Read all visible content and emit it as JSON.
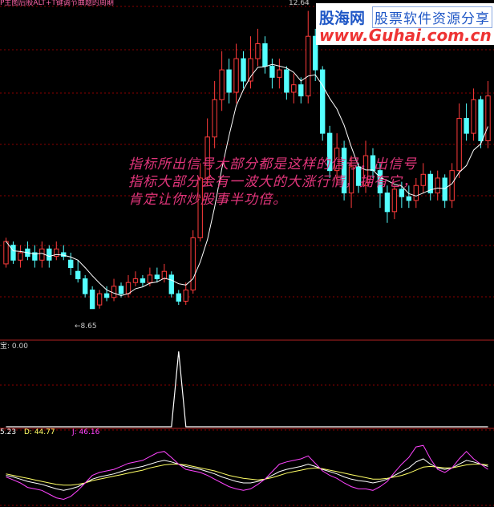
{
  "header": {
    "indicator_title": "P主图后股ALT+T键调节曲题的周期",
    "high_label": "12.64",
    "low_label": "←8.65"
  },
  "watermark": {
    "title": "股海网",
    "subtitle": "股票软件资源分享",
    "url": "www.Guhai.com.cn"
  },
  "annotation": {
    "line1": "指标所出信号大部分都是这样的信号，出信号",
    "line2": "指标大部分会有一波大的大涨行情，拥有它，",
    "line3": "肯定让你炒股事半功倍。"
  },
  "signal_panel": {
    "label": "宝: 0.00"
  },
  "kdj_panel": {
    "k_label": "5.23",
    "d_label": "D: 44.77",
    "j_label": "J: 46.16"
  },
  "colors": {
    "up": "#ff3b3b",
    "down": "#54ffff",
    "ma": "#ffffff",
    "grid": "#8b0000",
    "k": "#ffffff",
    "d": "#ffff66",
    "j": "#ff44ff"
  },
  "candles": [
    [
      9.25,
      9.55,
      9.6,
      9.2
    ],
    [
      9.5,
      9.3,
      9.55,
      9.25
    ],
    [
      9.3,
      9.4,
      9.5,
      9.2
    ],
    [
      9.45,
      9.35,
      9.55,
      9.3
    ],
    [
      9.4,
      9.3,
      9.5,
      9.2
    ],
    [
      9.3,
      9.45,
      9.55,
      9.2
    ],
    [
      9.45,
      9.3,
      9.5,
      9.2
    ],
    [
      9.35,
      9.45,
      9.55,
      9.3
    ],
    [
      9.4,
      9.35,
      9.5,
      9.3
    ],
    [
      9.3,
      9.2,
      9.4,
      9.1
    ],
    [
      9.15,
      9.05,
      9.3,
      9.0
    ],
    [
      9.05,
      8.85,
      9.1,
      8.8
    ],
    [
      8.9,
      8.65,
      8.95,
      8.65
    ],
    [
      8.7,
      8.85,
      8.9,
      8.65
    ],
    [
      8.85,
      8.8,
      8.95,
      8.75
    ],
    [
      8.8,
      8.95,
      9.05,
      8.75
    ],
    [
      8.95,
      8.85,
      9.0,
      8.8
    ],
    [
      8.85,
      9.0,
      9.1,
      8.8
    ],
    [
      9.0,
      9.05,
      9.15,
      8.95
    ],
    [
      9.05,
      9.0,
      9.1,
      8.95
    ],
    [
      9.0,
      9.1,
      9.2,
      8.95
    ],
    [
      9.1,
      9.05,
      9.2,
      9.0
    ],
    [
      9.05,
      9.15,
      9.25,
      9.0
    ],
    [
      9.1,
      8.85,
      9.15,
      8.8
    ],
    [
      8.85,
      8.75,
      8.9,
      8.7
    ],
    [
      8.75,
      8.9,
      9.0,
      8.7
    ],
    [
      8.9,
      9.6,
      9.7,
      8.85
    ],
    [
      9.6,
      10.4,
      10.6,
      9.55
    ],
    [
      10.4,
      10.95,
      11.2,
      10.3
    ],
    [
      10.95,
      11.45,
      11.7,
      10.8
    ],
    [
      11.45,
      11.85,
      12.1,
      11.3
    ],
    [
      11.85,
      11.55,
      12.0,
      11.4
    ],
    [
      11.55,
      12.0,
      12.2,
      11.4
    ],
    [
      12.0,
      11.7,
      12.1,
      11.6
    ],
    [
      11.7,
      12.0,
      12.3,
      11.6
    ],
    [
      12.0,
      12.2,
      12.4,
      11.9
    ],
    [
      12.2,
      11.9,
      12.3,
      11.8
    ],
    [
      11.9,
      11.75,
      12.0,
      11.6
    ],
    [
      11.75,
      11.85,
      12.0,
      11.6
    ],
    [
      11.85,
      11.55,
      11.9,
      11.45
    ],
    [
      11.55,
      11.65,
      11.8,
      11.4
    ],
    [
      11.65,
      11.5,
      11.75,
      11.4
    ],
    [
      11.5,
      12.3,
      12.64,
      11.4
    ],
    [
      12.3,
      11.85,
      12.4,
      11.7
    ],
    [
      11.85,
      11.0,
      11.9,
      10.9
    ],
    [
      11.0,
      10.5,
      11.1,
      10.4
    ],
    [
      10.5,
      10.8,
      11.0,
      10.3
    ],
    [
      10.8,
      10.2,
      10.9,
      10.1
    ],
    [
      10.2,
      10.55,
      10.7,
      10.0
    ],
    [
      10.55,
      10.3,
      10.6,
      10.2
    ],
    [
      10.3,
      10.7,
      10.9,
      10.2
    ],
    [
      10.7,
      10.5,
      10.8,
      10.4
    ],
    [
      10.5,
      10.2,
      10.6,
      10.0
    ],
    [
      10.2,
      9.95,
      10.3,
      9.8
    ],
    [
      9.95,
      10.25,
      10.3,
      9.85
    ],
    [
      10.25,
      10.15,
      10.35,
      10.0
    ],
    [
      10.15,
      10.1,
      10.3,
      10.0
    ],
    [
      10.1,
      10.3,
      10.4,
      10.0
    ],
    [
      10.3,
      10.45,
      10.6,
      10.2
    ],
    [
      10.45,
      10.2,
      10.5,
      10.1
    ],
    [
      10.2,
      10.4,
      10.5,
      10.1
    ],
    [
      10.4,
      10.1,
      10.45,
      10.0
    ],
    [
      10.1,
      10.5,
      10.6,
      10.0
    ],
    [
      10.5,
      11.2,
      11.4,
      10.4
    ],
    [
      11.2,
      11.0,
      11.4,
      10.9
    ],
    [
      11.0,
      11.45,
      11.6,
      10.9
    ],
    [
      11.45,
      10.9,
      11.5,
      10.8
    ],
    [
      10.9,
      11.5,
      11.7,
      10.8
    ]
  ],
  "signal_values": [
    0,
    0,
    0,
    0,
    0,
    0,
    0,
    0,
    0,
    0,
    0,
    0,
    0,
    0,
    0,
    0,
    0,
    0,
    0,
    0,
    0,
    0,
    0,
    0,
    1,
    0,
    0,
    0,
    0,
    0,
    0,
    0,
    0,
    0,
    0,
    0,
    0,
    0,
    0,
    0,
    0,
    0,
    0,
    0,
    0,
    0,
    0,
    0,
    0,
    0,
    0,
    0,
    0,
    0,
    0,
    0,
    0,
    0,
    0,
    0,
    0,
    0,
    0,
    0,
    0,
    0,
    0,
    0
  ],
  "kdj": {
    "k": [
      40,
      38,
      35,
      32,
      30,
      28,
      25,
      22,
      20,
      22,
      25,
      30,
      35,
      38,
      40,
      42,
      45,
      48,
      50,
      52,
      55,
      58,
      60,
      58,
      55,
      52,
      50,
      48,
      45,
      42,
      38,
      35,
      32,
      30,
      30,
      32,
      35,
      40,
      45,
      48,
      50,
      52,
      55,
      52,
      48,
      45,
      42,
      38,
      35,
      33,
      32,
      30,
      32,
      35,
      40,
      45,
      50,
      58,
      62,
      55,
      50,
      48,
      50,
      55,
      60,
      58,
      55,
      52
    ],
    "d": [
      42,
      40,
      38,
      36,
      34,
      32,
      30,
      28,
      27,
      27,
      28,
      30,
      33,
      35,
      37,
      39,
      41,
      43,
      45,
      47,
      50,
      52,
      54,
      55,
      55,
      54,
      52,
      50,
      48,
      46,
      43,
      40,
      38,
      36,
      35,
      34,
      35,
      37,
      40,
      43,
      45,
      47,
      49,
      50,
      49,
      47,
      45,
      43,
      41,
      39,
      37,
      35,
      35,
      36,
      38,
      40,
      43,
      47,
      51,
      52,
      51,
      50,
      50,
      52,
      54,
      55,
      55,
      54
    ],
    "j": [
      38,
      34,
      30,
      24,
      22,
      20,
      15,
      10,
      8,
      12,
      20,
      30,
      40,
      44,
      46,
      48,
      52,
      56,
      58,
      60,
      65,
      70,
      72,
      64,
      55,
      48,
      46,
      44,
      40,
      35,
      30,
      25,
      22,
      20,
      22,
      28,
      35,
      45,
      55,
      58,
      60,
      62,
      66,
      56,
      46,
      40,
      36,
      30,
      25,
      22,
      22,
      20,
      25,
      32,
      44,
      55,
      64,
      78,
      80,
      62,
      48,
      44,
      50,
      62,
      72,
      62,
      55,
      48
    ]
  }
}
